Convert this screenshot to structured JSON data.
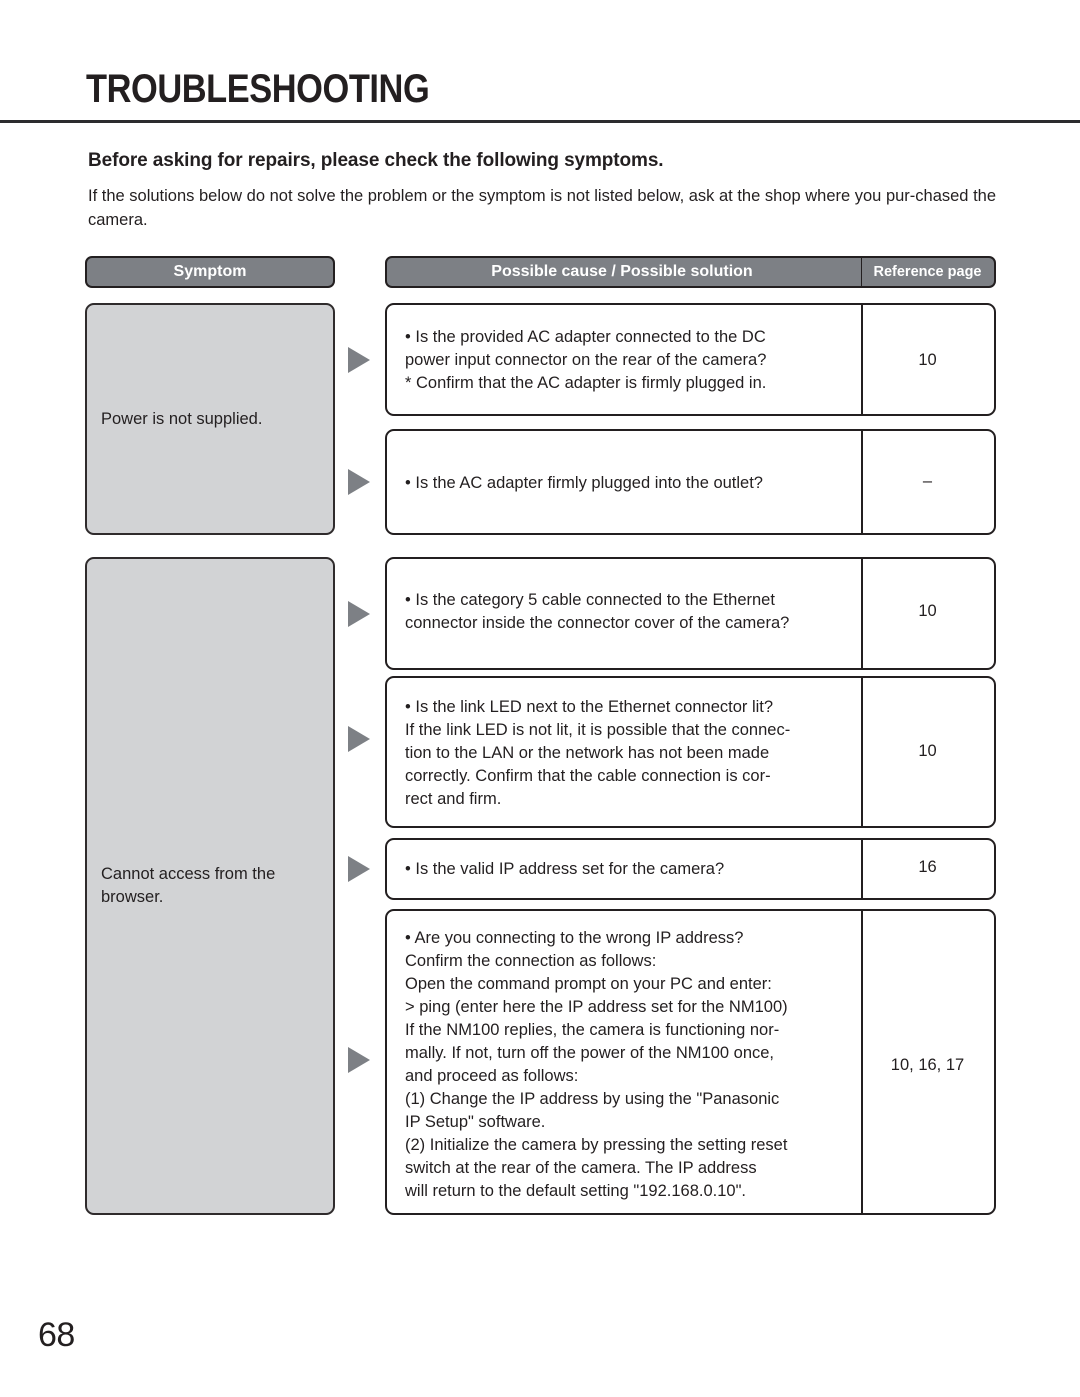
{
  "page": {
    "title": "TROUBLESHOOTING",
    "number": "68",
    "intro_heading": "Before asking for repairs, please check the following symptoms.",
    "intro_body": "If the solutions below do not solve the problem or the symptom is not listed below, ask at the shop where you pur-chased the camera."
  },
  "table": {
    "headers": {
      "symptom": "Symptom",
      "cause": "Possible cause / Possible solution",
      "reference": "Reference page"
    },
    "symptoms": [
      {
        "label": "Power is not supplied."
      },
      {
        "label": "Cannot access from the browser."
      }
    ],
    "rows": [
      {
        "cause": "• Is the provided AC adapter connected to the DC\n   power input connector on the rear of the camera?\n* Confirm that the AC adapter is firmly plugged in.",
        "reference": "10"
      },
      {
        "cause": "• Is the AC adapter firmly plugged into the outlet?",
        "reference": "–"
      },
      {
        "cause": "• Is the category 5 cable connected to the Ethernet\n   connector inside the connector cover of the camera?",
        "reference": "10"
      },
      {
        "cause": "• Is the link LED next to the Ethernet connector lit?\n   If the link LED is not lit, it is possible that the connec-\n   tion to the LAN or the network has not been made\n   correctly. Confirm that the cable connection is cor-\n   rect and firm.",
        "reference": "10"
      },
      {
        "cause": "• Is the valid IP address set for the camera?",
        "reference": "16"
      },
      {
        "cause": "• Are you connecting to the wrong IP address?\n   Confirm the connection as follows:\n   Open the command prompt on your PC and enter:\n   > ping (enter here the IP address set for the NM100)\n   If the NM100 replies, the camera is functioning nor-\n   mally. If not, turn off the power of the NM100 once,\n   and proceed as follows:\n   (1)  Change the IP address by using the \"Panasonic\n         IP Setup\" software.\n   (2)  Initialize the camera by pressing the setting reset\n         switch at the rear of the camera. The IP address\n         will return to the default setting \"192.168.0.10\".",
        "reference": "10, 16, 17"
      }
    ],
    "arrows": [
      "arrow-right-icon",
      "arrow-right-icon",
      "arrow-right-icon",
      "arrow-right-icon",
      "arrow-right-icon",
      "arrow-right-icon"
    ]
  },
  "colors": {
    "header_gray": "#7d8085",
    "symptom_gray": "#d2d3d5",
    "ink": "#231f20"
  }
}
